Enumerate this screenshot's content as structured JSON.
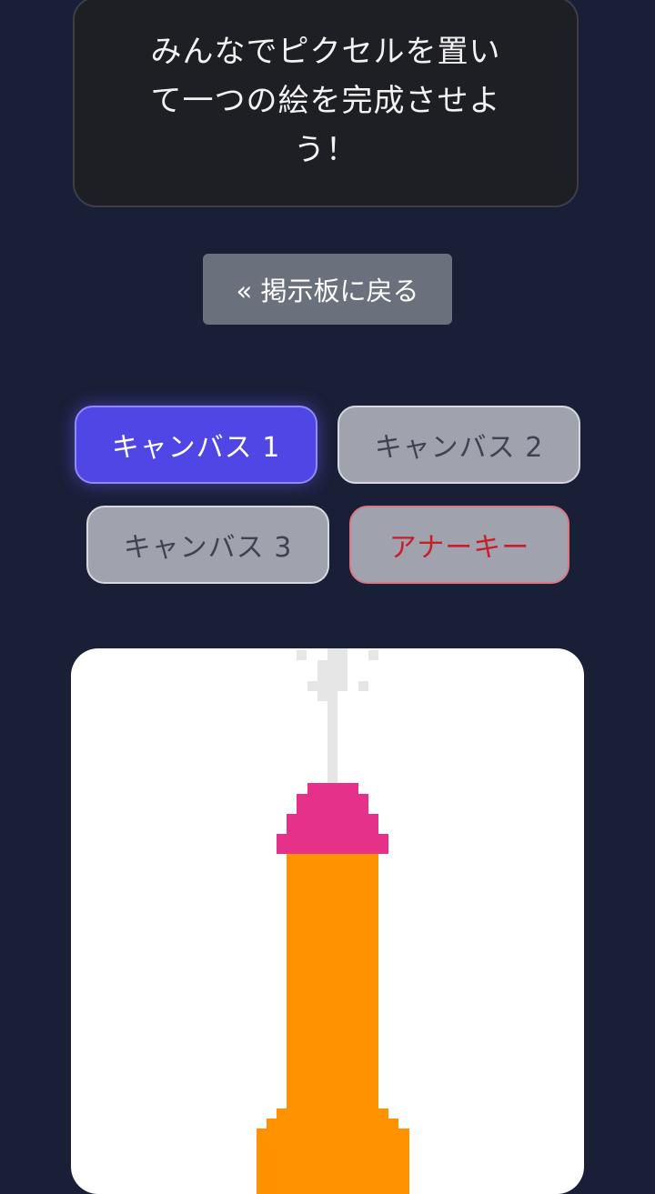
{
  "notice": {
    "text": "みんなでピクセルを置いて一つの絵を完成させよう！"
  },
  "back_button": {
    "label": "« 掲示板に戻る"
  },
  "canvas_tabs": [
    {
      "label": "キャンバス 1",
      "state": "active"
    },
    {
      "label": "キャンバス 2",
      "state": "inactive"
    },
    {
      "label": "キャンバス 3",
      "state": "inactive"
    },
    {
      "label": "アナーキー",
      "state": "inactive"
    }
  ],
  "colors": {
    "page_background": "#1a1f38",
    "active_tab": "#4f46e5",
    "anarchy_text": "#c71f2a",
    "pixel_gray": "#e6e6e6",
    "pixel_pink": "#e6318a",
    "pixel_orange": "#ff9200"
  }
}
